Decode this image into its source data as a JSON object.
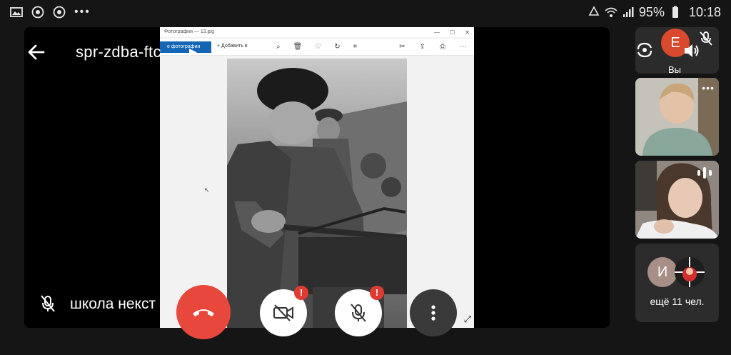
{
  "status_bar": {
    "battery": "95%",
    "time": "10:18",
    "left_icons": [
      "image-icon",
      "chrome-icon",
      "chrome-icon",
      "more-dots-icon"
    ],
    "right_icons": [
      "recycle-icon",
      "wifi-icon",
      "signal-icon",
      "battery-icon"
    ]
  },
  "meeting": {
    "code": "spr-zdba-ftc",
    "presenter_name": "школа некст"
  },
  "shared_window": {
    "title": "Фотографии — 13.jpg",
    "tab_label": "е фотографии",
    "add_label": "Добавить в"
  },
  "self_tile": {
    "avatar_letter": "E",
    "label": "Вы",
    "avatar_color": "#d9492d"
  },
  "more_tile": {
    "avatar_letter": "И",
    "label": "ещё 11 чел."
  },
  "controls": {
    "warn_badge": "!",
    "end_call_color": "#e8473b"
  }
}
